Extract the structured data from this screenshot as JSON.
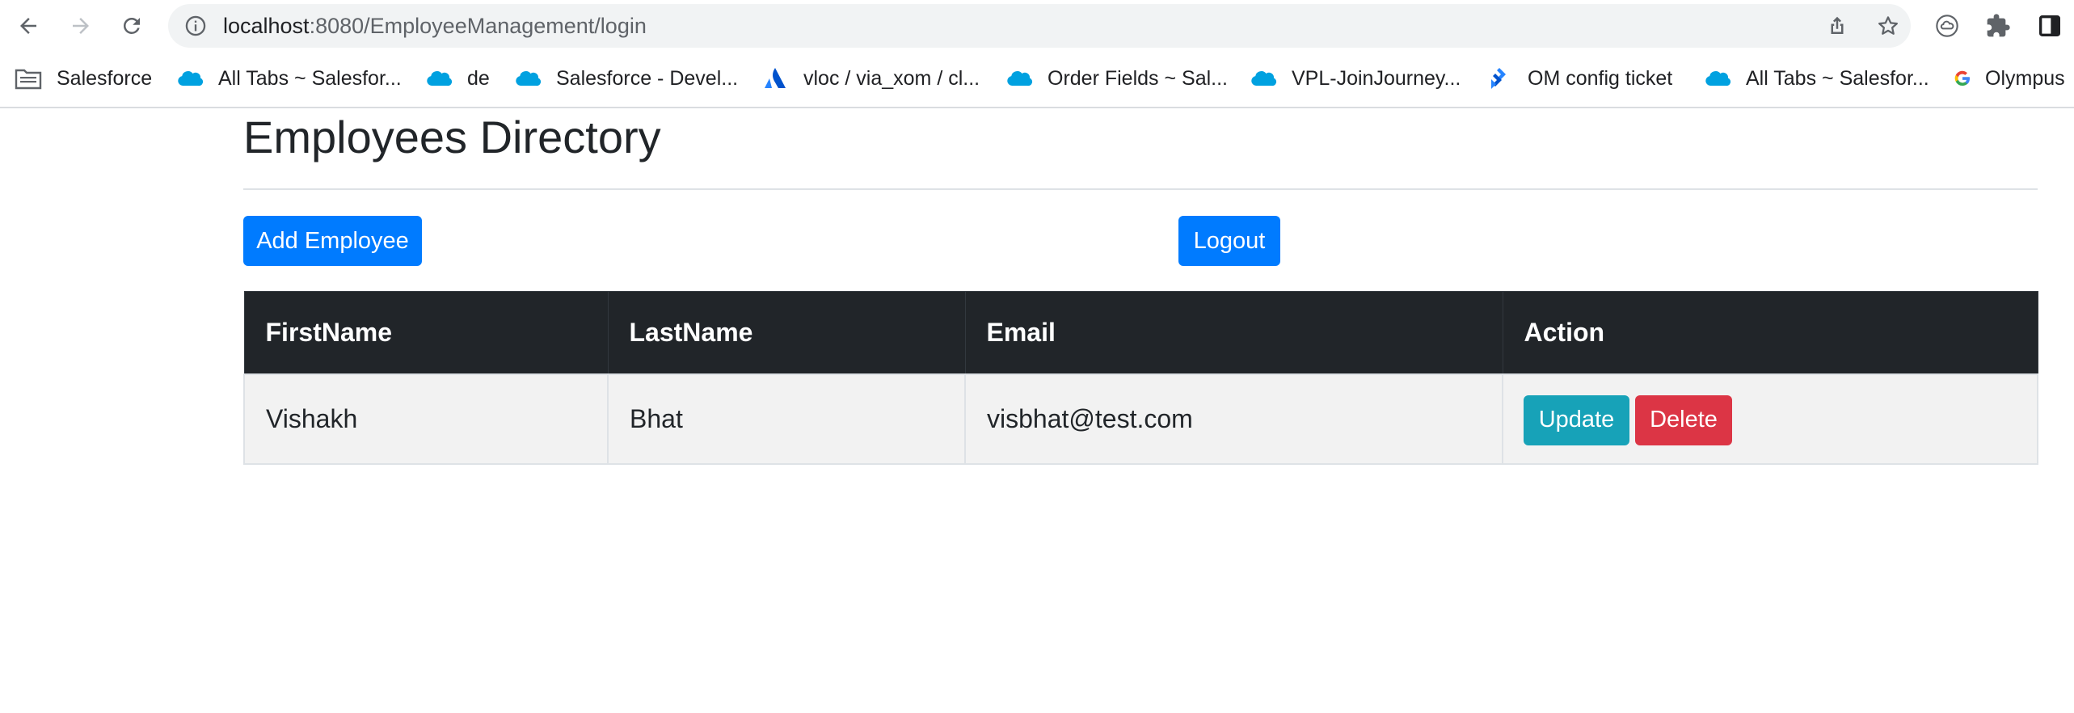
{
  "browser": {
    "url_host": "localhost",
    "url_path": ":8080/EmployeeManagement/login",
    "bookmarks": [
      {
        "label": "Salesforce",
        "icon": "folder-icon"
      },
      {
        "label": "All Tabs ~ Salesfor...",
        "icon": "salesforce-cloud-icon"
      },
      {
        "label": "de",
        "icon": "salesforce-cloud-icon"
      },
      {
        "label": "Salesforce - Devel...",
        "icon": "salesforce-cloud-icon"
      },
      {
        "label": "vloc / via_xom / cl...",
        "icon": "atlassian-icon"
      },
      {
        "label": "Order Fields ~ Sal...",
        "icon": "salesforce-cloud-icon"
      },
      {
        "label": "VPL-JoinJourney...",
        "icon": "salesforce-cloud-icon"
      },
      {
        "label": "OM config ticket",
        "icon": "jira-icon"
      },
      {
        "label": "All Tabs ~ Salesfor...",
        "icon": "salesforce-cloud-icon"
      },
      {
        "label": "Olympus",
        "icon": "google-icon"
      }
    ]
  },
  "page": {
    "title": "Employees Directory",
    "add_button": "Add Employee",
    "logout_button": "Logout"
  },
  "table": {
    "headers": [
      "FirstName",
      "LastName",
      "Email",
      "Action"
    ],
    "rows": [
      {
        "first_name": "Vishakh",
        "last_name": "Bhat",
        "email": "visbhat@test.com",
        "update_label": "Update",
        "delete_label": "Delete"
      }
    ]
  },
  "colors": {
    "primary": "#007bff",
    "info": "#17a2b8",
    "danger": "#dc3545",
    "table_header": "#212529",
    "salesforce_blue": "#00a1e0"
  }
}
